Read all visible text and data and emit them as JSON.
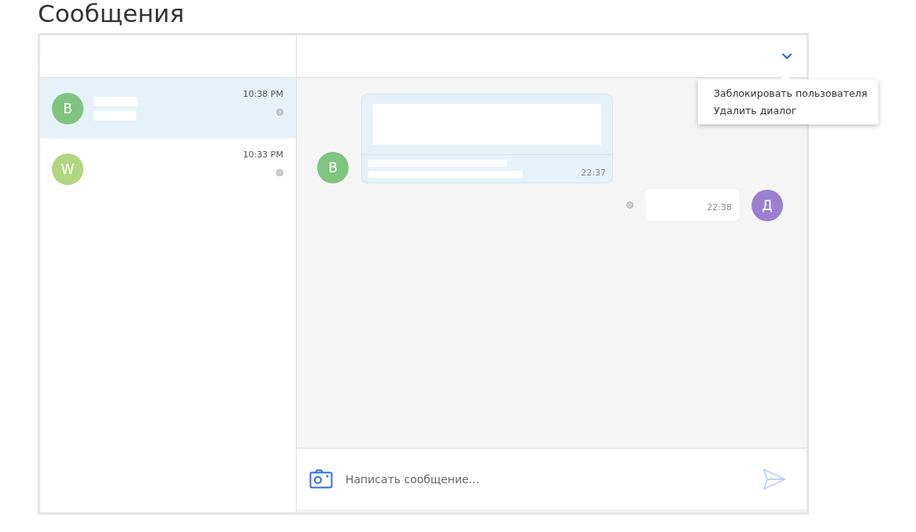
{
  "page_title": "Сообщения",
  "conversations": [
    {
      "avatar": "B",
      "color": "#7fc47f",
      "time": "10:38 PM",
      "selected": true
    },
    {
      "avatar": "W",
      "color": "#b0d67f",
      "time": "10:33 PM",
      "selected": false
    }
  ],
  "menu": [
    "Заблокировать пользователя",
    "Удалить диалог"
  ],
  "messages": [
    {
      "kind": "incoming",
      "avatar": "B",
      "color": "#7fc47f",
      "time": "22:37",
      "attachment": true
    },
    {
      "kind": "outgoing",
      "avatar": "Д",
      "color": "#9b7fd1",
      "time": "22:38",
      "attachment": false
    }
  ],
  "composer": {
    "placeholder": "Написать сообщение..."
  }
}
